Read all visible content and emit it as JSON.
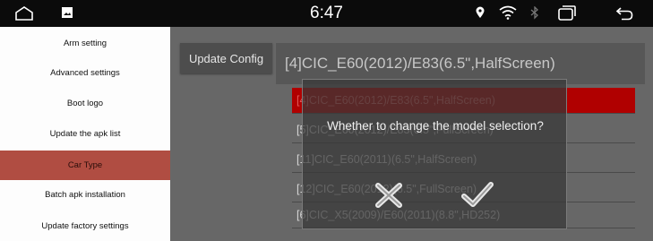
{
  "status_bar": {
    "time": "6:47",
    "icons": [
      "home-icon",
      "gallery-icon",
      "location-icon",
      "wifi-icon",
      "bluetooth-icon",
      "recents-icon",
      "back-icon"
    ]
  },
  "sidebar": {
    "items": [
      {
        "label": "Arm setting",
        "active": false
      },
      {
        "label": "Advanced settings",
        "active": false
      },
      {
        "label": "Boot logo",
        "active": false
      },
      {
        "label": "Update the apk list",
        "active": false
      },
      {
        "label": "Car Type",
        "active": true
      },
      {
        "label": "Batch apk installation",
        "active": false
      },
      {
        "label": "Update factory settings",
        "active": false
      }
    ]
  },
  "main": {
    "update_button": "Update Config",
    "current_model": "[4]CIC_E60(2012)/E83(6.5\",HalfScreen)",
    "models": [
      {
        "label": "[4]CIC_E60(2012)/E83(6.5\",HalfScreen)",
        "selected": true
      },
      {
        "label": "[5]CIC_E60(2012)/E83(6.5\",FullScreen)",
        "selected": false
      },
      {
        "label": "[11]CIC_E60(2011)(6.5\",HalfScreen)",
        "selected": false
      },
      {
        "label": "[12]CIC_E60(2012)(6.5\",FullScreen)",
        "selected": false
      },
      {
        "label": "[6]CIC_X5(2009)/E60(2011)(8.8\",HD252)",
        "selected": false
      }
    ]
  },
  "dialog": {
    "message": "Whether to change the model selection?",
    "cancel_icon": "cross-icon",
    "confirm_icon": "check-icon"
  },
  "colors": {
    "active_item": "#b04d42",
    "selected_row": "#b00000",
    "panel": "#676767"
  }
}
